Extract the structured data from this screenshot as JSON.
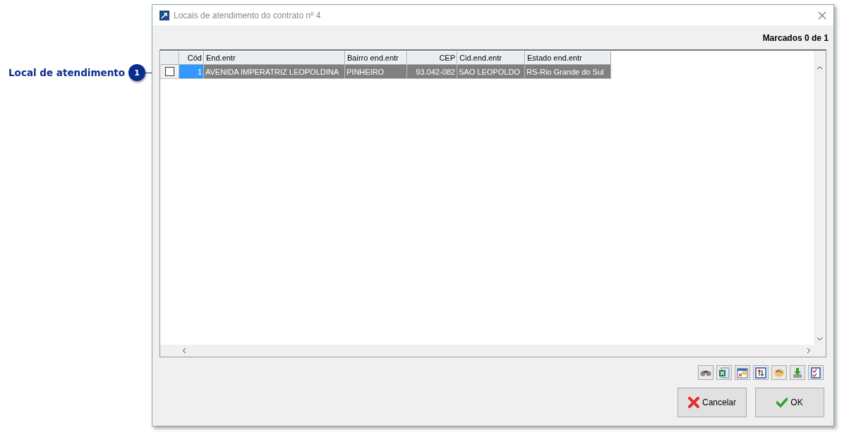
{
  "callout": {
    "label": "Local de atendimento",
    "number": "1"
  },
  "window": {
    "title": "Locais de atendimento do contrato nº 4"
  },
  "counter": "Marcados 0 de 1",
  "table": {
    "columns": [
      {
        "label": "Cód"
      },
      {
        "label": "End.entr"
      },
      {
        "label": "Bairro end.entr"
      },
      {
        "label": "CEP"
      },
      {
        "label": "Cid.end.entr"
      },
      {
        "label": "Estado end.entr"
      }
    ],
    "rows": [
      {
        "checked": false,
        "selected": true,
        "cells": [
          "1",
          "AVENIDA IMPERATRIZ LEOPOLDINA",
          "PINHEIRO",
          "93.042-082",
          "SAO LEOPOLDO",
          "RS-Rio Grande do Sul"
        ]
      }
    ]
  },
  "toolbar": [
    {
      "kind": "binoculars"
    },
    {
      "kind": "excel"
    },
    {
      "kind": "layout"
    },
    {
      "kind": "sort"
    },
    {
      "kind": "palette"
    },
    {
      "kind": "download"
    },
    {
      "kind": "checklist"
    }
  ],
  "buttons": [
    {
      "kind": "cancel",
      "label": "Cancelar"
    },
    {
      "kind": "ok",
      "label": "OK"
    }
  ]
}
